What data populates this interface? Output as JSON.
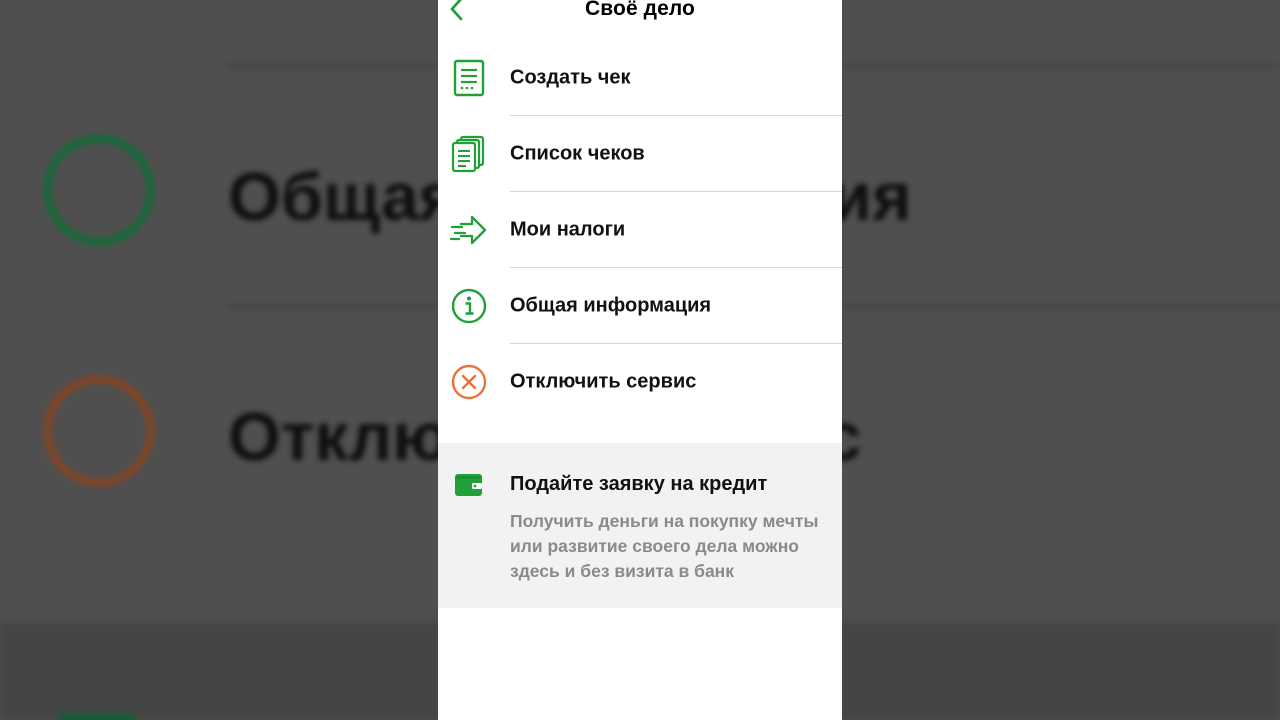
{
  "colors": {
    "accent_green": "#21a038",
    "accent_orange": "#e8733a",
    "promo_bg": "#f2f2f2"
  },
  "nav": {
    "title": "Своё дело",
    "back_icon": "chevron-left-icon"
  },
  "menu": {
    "items": [
      {
        "label": "Создать чек",
        "icon": "receipt-icon"
      },
      {
        "label": "Список чеков",
        "icon": "receipts-list-icon"
      },
      {
        "label": "Мои налоги",
        "icon": "arrow-right-motion-icon"
      },
      {
        "label": "Общая информация",
        "icon": "info-icon"
      },
      {
        "label": "Отключить сервис",
        "icon": "close-circle-icon"
      }
    ]
  },
  "promo": {
    "icon": "wallet-icon",
    "title": "Подайте заявку на кредит",
    "text": "Получить деньги на покупку мечты или развитие своего дела можно здесь и без визита в банк"
  },
  "background": {
    "info_text": "Общая информация",
    "disable_text": "Отключить сервис"
  }
}
